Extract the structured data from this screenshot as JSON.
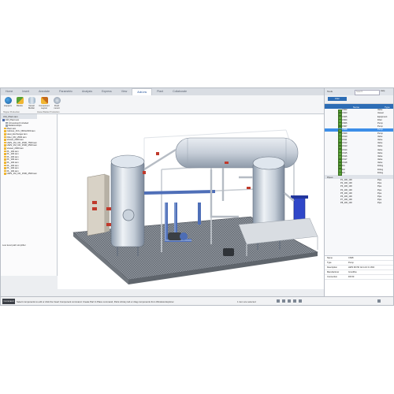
{
  "ribbon": {
    "tabs": [
      "Home",
      "Insert",
      "Annotate",
      "Parametric",
      "Analysis",
      "Express",
      "View",
      "Add-ins",
      "Plant",
      "Collaborate"
    ],
    "active_tab": "Add-ins",
    "buttons": [
      "Hoppers",
      "Blocks",
      "Vessel Builder",
      "Component Layout",
      "Flush mount"
    ],
    "groups": [
      "Hopper Production",
      "Vessel Builder Production"
    ]
  },
  "tree": {
    "tab_label": "CM_Plant.iam",
    "items": [
      "CM_Plant.iam",
      "Unresolved Included",
      "Relationships",
      "Plant.iam",
      "Cabinet_FCU_800x2000.iam",
      "Heat_Exchanger.iam",
      "Filter_DN_2500.iam",
      "Vessel_2000.iam",
      "HWS_1M_CD_2500_7500.iam",
      "HWS_1M_CD_1500_2500.iam",
      "Vessel_2000.iam",
      "PL_100.iam",
      "PL_100.iam",
      "PL_100.iam",
      "PL_100.iam",
      "PL_100.iam",
      "PL_100.iam",
      "PL_100.iam",
      "PL_100.iam",
      "HWS_1M_CD_1500_2500.iam"
    ],
    "status_message": "Low level path simplifier"
  },
  "right_panel": {
    "title": "Tools",
    "search_placeholder": "Search",
    "help_label": "Help",
    "filter_button": "Filter",
    "header": {
      "name": "Name",
      "type": "Type"
    },
    "parts": [
      {
        "name": "CS02",
        "type": "Valve",
        "selected": false
      },
      {
        "name": "CS03",
        "type": "Vessel",
        "selected": false
      },
      {
        "name": "CS05",
        "type": "Equipment",
        "selected": false
      },
      {
        "name": "CS04",
        "type": "Filter",
        "selected": false
      },
      {
        "name": "CS06",
        "type": "Pump",
        "selected": false
      },
      {
        "name": "CS07",
        "type": "Pump",
        "selected": false
      },
      {
        "name": "CS08",
        "type": "Pump",
        "selected": true
      },
      {
        "name": "CS09",
        "type": "Pump",
        "selected": false
      },
      {
        "name": "CS10",
        "type": "Valve",
        "selected": false
      },
      {
        "name": "CS11",
        "type": "Valve",
        "selected": false
      },
      {
        "name": "CS12",
        "type": "Valve",
        "selected": false
      },
      {
        "name": "CS13",
        "type": "Valve",
        "selected": false
      },
      {
        "name": "CS14",
        "type": "Valve",
        "selected": false
      },
      {
        "name": "CS15",
        "type": "Valve",
        "selected": false
      },
      {
        "name": "CS16",
        "type": "Valve",
        "selected": false
      },
      {
        "name": "CS17",
        "type": "Valve",
        "selected": false
      },
      {
        "name": "CS18",
        "type": "Valve",
        "selected": false
      },
      {
        "name": "FI1",
        "type": "Fitting",
        "selected": false
      },
      {
        "name": "FI2",
        "type": "Fitting",
        "selected": false
      },
      {
        "name": "FI3",
        "type": "Fitting",
        "selected": false
      }
    ],
    "section": "Pipes",
    "pipes": [
      {
        "name": "P1_100_100",
        "type": "Pipe"
      },
      {
        "name": "P2_100_100",
        "type": "Pipe"
      },
      {
        "name": "P3_100_100",
        "type": "Pipe"
      },
      {
        "name": "P4_100_100",
        "type": "Pipe"
      },
      {
        "name": "P5_100_100",
        "type": "Pipe"
      },
      {
        "name": "P6_100_100",
        "type": "Pipe"
      },
      {
        "name": "P7_100_100",
        "type": "Pipe"
      },
      {
        "name": "P8_100_100",
        "type": "Pipe"
      }
    ],
    "properties": [
      {
        "key": "Name",
        "value": "CS08"
      },
      {
        "key": "Type",
        "value": "Pump"
      },
      {
        "key": "Description",
        "value": "HWS DN 50 G4 14.0 0.4 B/4"
      },
      {
        "key": "Manufacturer",
        "value": "Grundfos"
      },
      {
        "key": "Connection",
        "value": "DN 50"
      }
    ]
  },
  "command_bar": {
    "label": "Command",
    "text": "Select components to edit or click the Insert Component command. Create Part In Place command, Parts Library tab or drag components from Windows Explorer.",
    "selection": "1 item are selected"
  },
  "colors": {
    "accent": "#2d6db5",
    "selected_row": "#3c8ee8",
    "vessel": "#c9d3de",
    "pipe_blue": "#4f6fb8",
    "grating": "#7d838b"
  }
}
